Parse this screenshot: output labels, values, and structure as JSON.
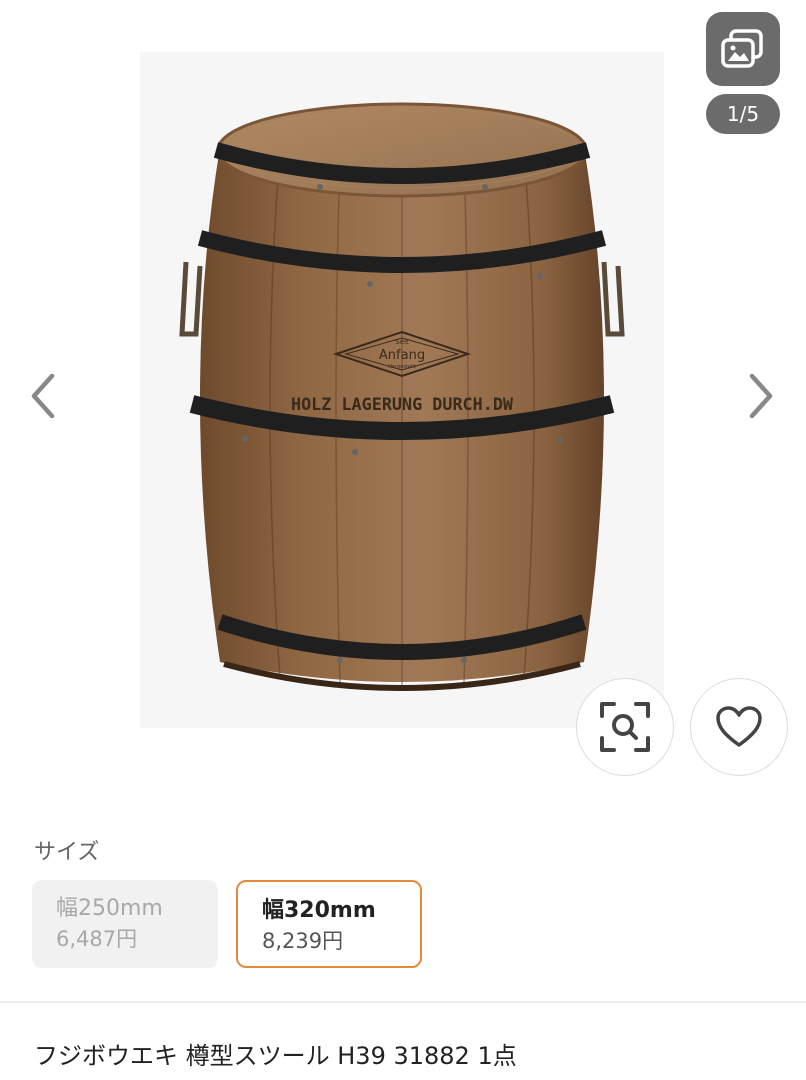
{
  "gallery": {
    "counter": "1/5",
    "image_alt": "wooden barrel stool",
    "icons": {
      "gallery": "gallery-icon",
      "prev": "chevron-left-icon",
      "next": "chevron-right-icon",
      "lens": "image-search-icon",
      "favorite": "heart-icon"
    },
    "barrel_print": {
      "emblem_top": "Seit",
      "emblem_brand": "Anfang",
      "emblem_bottom": "Hergestellt",
      "stencil": "HOLZ LAGERUNG DURCH.DW"
    }
  },
  "size": {
    "label": "サイズ",
    "options": [
      {
        "name": "幅250mm",
        "price": "6,487円",
        "state": "disabled"
      },
      {
        "name": "幅320mm",
        "price": "8,239円",
        "state": "selected"
      }
    ]
  },
  "product": {
    "title": "フジボウエキ 樽型スツール H39 31882 1点"
  },
  "colors": {
    "accent": "#e6893a",
    "overlay": "#6b6b6b"
  }
}
